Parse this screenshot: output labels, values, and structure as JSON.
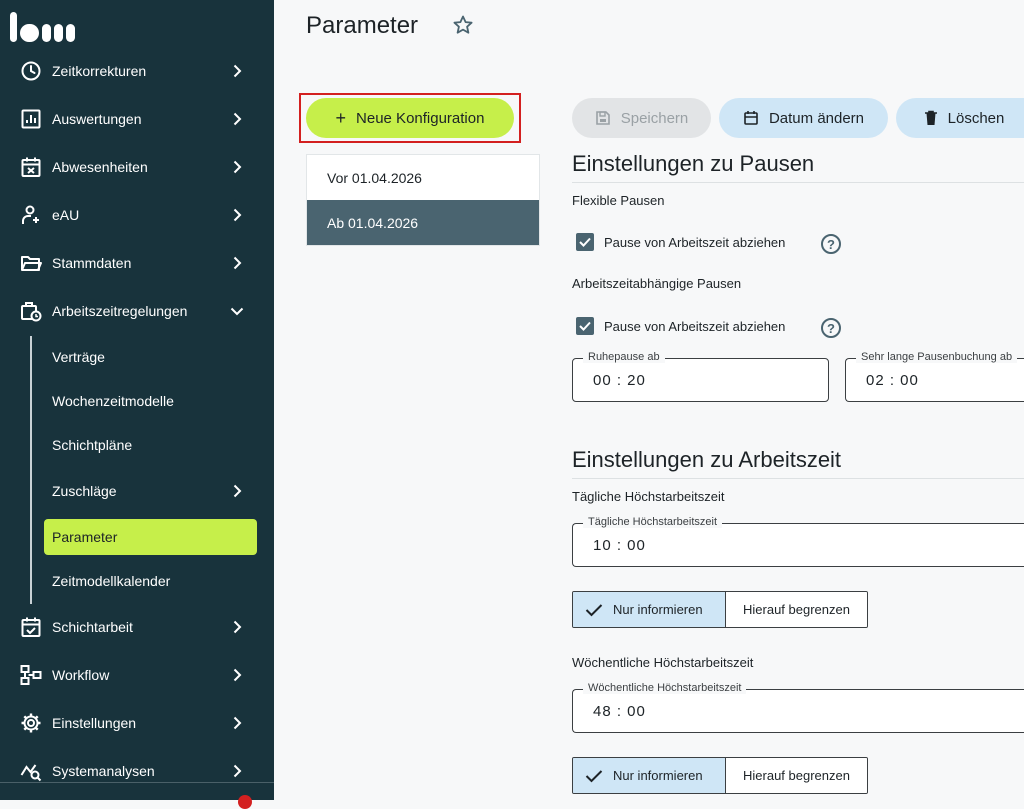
{
  "sidebar": {
    "items": [
      {
        "label": "Zeitkorrekturen",
        "icon": "clock-icon"
      },
      {
        "label": "Auswertungen",
        "icon": "chart-icon"
      },
      {
        "label": "Abwesenheiten",
        "icon": "calendar-x-icon"
      },
      {
        "label": "eAU",
        "icon": "person-medical-icon"
      },
      {
        "label": "Stammdaten",
        "icon": "folder-icon"
      },
      {
        "label": "Arbeitszeitregelungen",
        "icon": "briefcase-clock-icon"
      }
    ],
    "subitems": [
      {
        "label": "Verträge"
      },
      {
        "label": "Wochenzeitmodelle"
      },
      {
        "label": "Schichtpläne"
      },
      {
        "label": "Zuschläge"
      },
      {
        "label": "Parameter"
      },
      {
        "label": "Zeitmodellkalender"
      }
    ],
    "items_bottom": [
      {
        "label": "Schichtarbeit",
        "icon": "calendar-check-icon"
      },
      {
        "label": "Workflow",
        "icon": "workflow-icon"
      },
      {
        "label": "Einstellungen",
        "icon": "gear-icon"
      },
      {
        "label": "Systemanalysen",
        "icon": "analysis-icon"
      }
    ]
  },
  "page": {
    "title": "Parameter"
  },
  "toolbar": {
    "new_config": "Neue Konfiguration",
    "save": "Speichern",
    "change_date": "Datum ändern",
    "delete": "Löschen"
  },
  "configs": [
    {
      "label": "Vor 01.04.2026",
      "selected": false
    },
    {
      "label": "Ab 01.04.2026",
      "selected": true
    }
  ],
  "pausen": {
    "title": "Einstellungen zu Pausen",
    "flexible_heading": "Flexible Pausen",
    "flexible_checkbox": "Pause von Arbeitszeit abziehen",
    "abh_heading": "Arbeitszeitabhängige Pausen",
    "abh_checkbox": "Pause von Arbeitszeit abziehen",
    "ruhepause_label": "Ruhepause ab",
    "ruhepause_value": "00 : 20",
    "lange_label": "Sehr lange Pausenbuchung ab",
    "lange_value": "02 : 00"
  },
  "arbeitszeit": {
    "title": "Einstellungen zu Arbeitszeit",
    "daily_heading": "Tägliche Höchstarbeitszeit",
    "daily_label": "Tägliche Höchstarbeitszeit",
    "daily_value": "10 : 00",
    "weekly_heading": "Wöchentliche Höchstarbeitszeit",
    "weekly_label": "Wöchentliche Höchstarbeitszeit",
    "weekly_value": "48 : 00",
    "opt_inform": "Nur informieren",
    "opt_limit": "Hierauf begrenzen"
  },
  "colors": {
    "sidebar_bg": "#18333c",
    "accent_green": "#c6ef4a",
    "accent_blue": "#cfe6f6",
    "selected_item": "#4a6470"
  }
}
